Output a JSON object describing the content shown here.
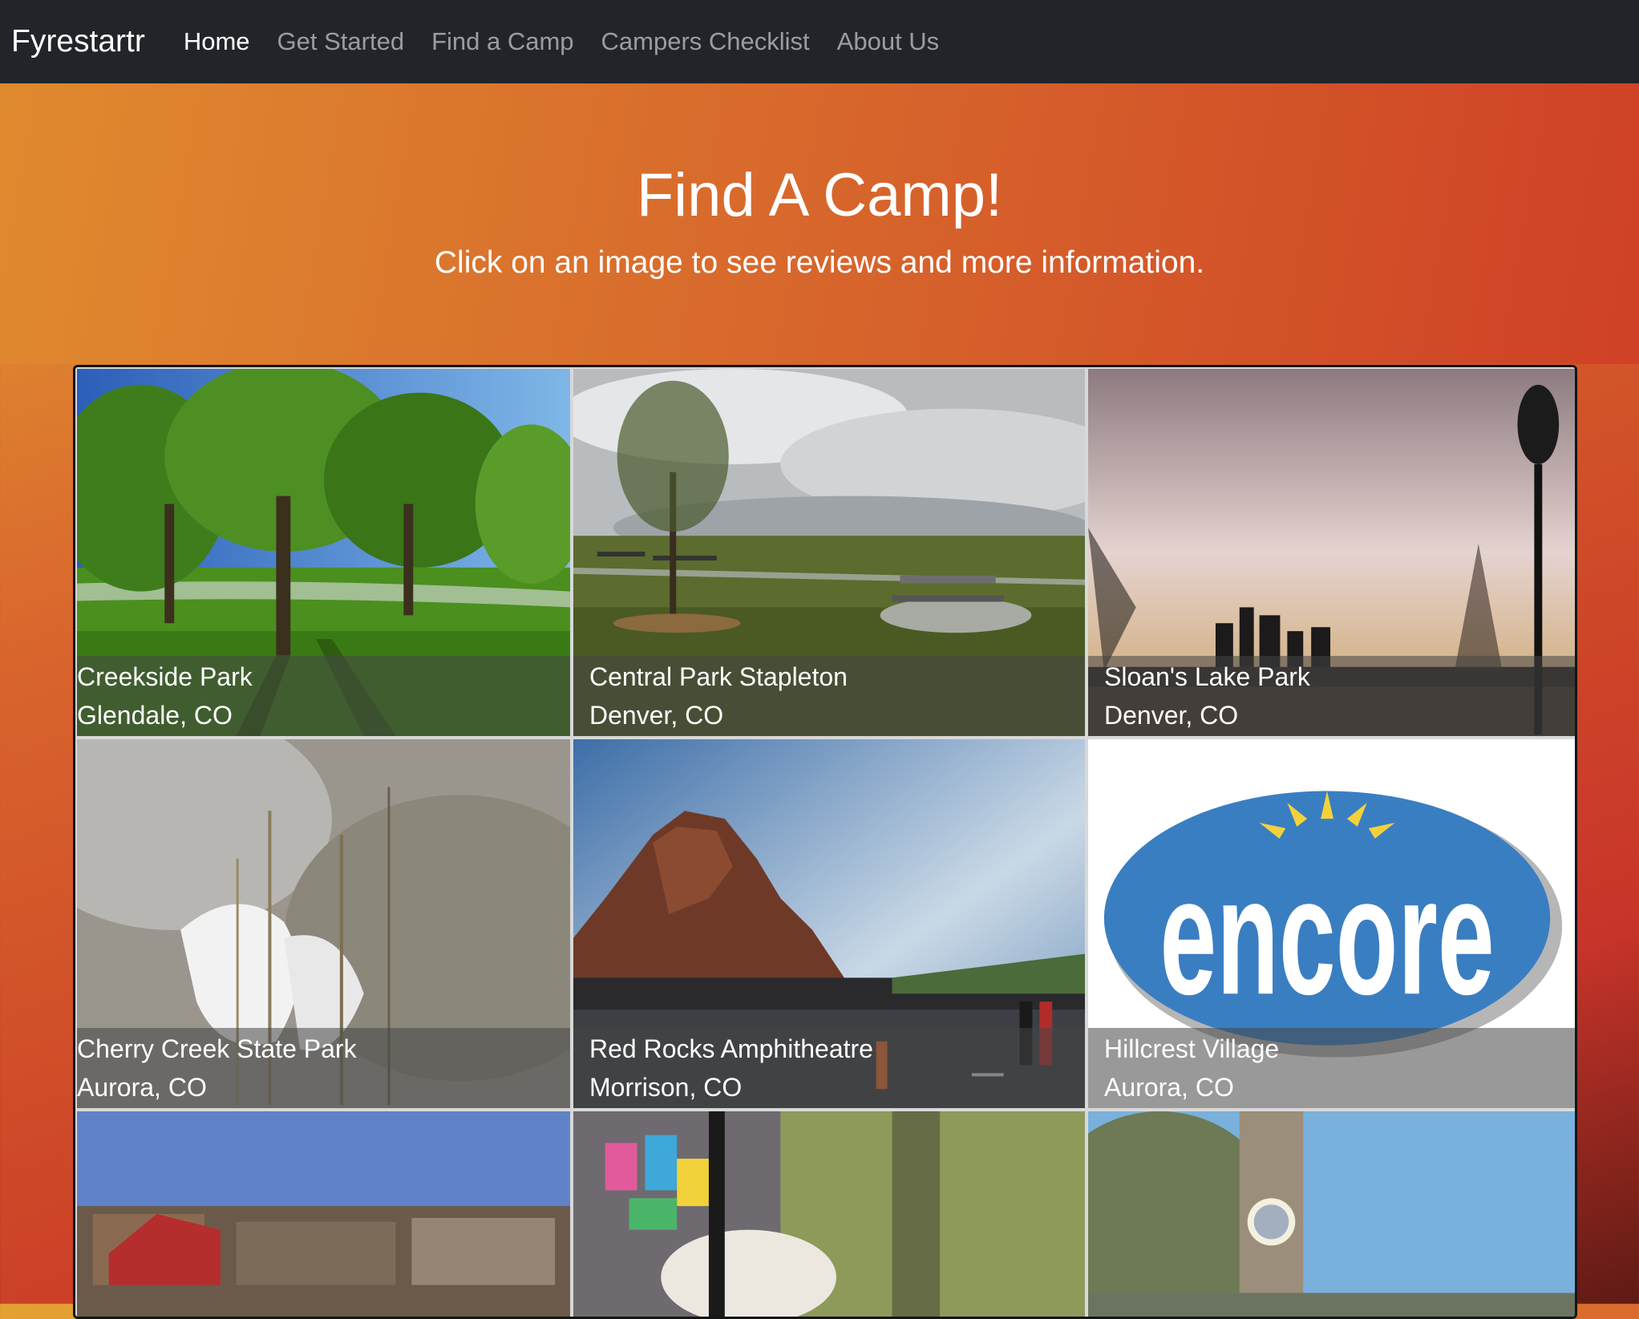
{
  "navbar": {
    "brand": "Fyrestartr",
    "items": [
      {
        "label": "Home",
        "active": true
      },
      {
        "label": "Get Started",
        "active": false
      },
      {
        "label": "Find a Camp",
        "active": false
      },
      {
        "label": "Campers Checklist",
        "active": false
      },
      {
        "label": "About Us",
        "active": false
      }
    ]
  },
  "hero": {
    "title": "Find A Camp!",
    "subtitle": "Click on an image to see reviews and more information."
  },
  "camps": [
    {
      "name": "Creekside Park",
      "location": "Glendale, CO"
    },
    {
      "name": "Central Park Stapleton",
      "location": "Denver, CO"
    },
    {
      "name": "Sloan's Lake Park",
      "location": "Denver, CO"
    },
    {
      "name": "Cherry Creek State Park",
      "location": "Aurora, CO"
    },
    {
      "name": "Red Rocks Amphitheatre",
      "location": "Morrison, CO"
    },
    {
      "name": "Hillcrest Village",
      "location": "Aurora, CO"
    }
  ],
  "logo_text": "encore",
  "colors": {
    "navbar": "#212529",
    "accent": "#d9652d"
  }
}
